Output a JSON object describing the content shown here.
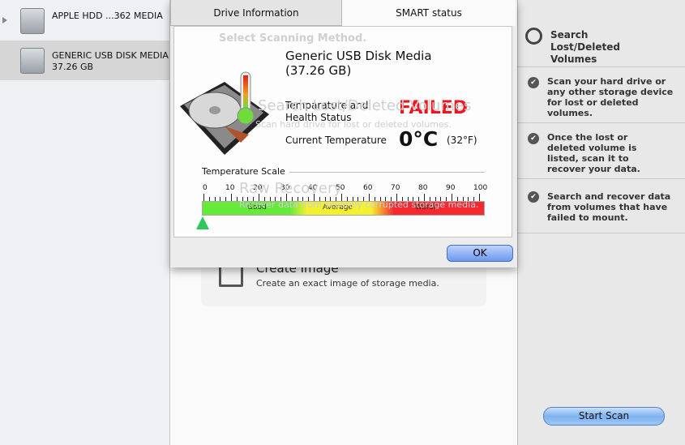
{
  "sidebar": {
    "drives": [
      {
        "name": "APPLE HDD ...362 MEDIA",
        "size": "",
        "expanded": false,
        "selected": false
      },
      {
        "name": "GENERIC USB DISK MEDIA",
        "size": "37.26 GB",
        "selected": true
      }
    ]
  },
  "background": {
    "heading": "Select Scanning Method.",
    "option1_title": "Search Lost/Deleted Volumes",
    "option1_desc": "Scan hard drive for lost or deleted volumes.",
    "option2_title": "Raw Recovery",
    "option2_desc": "Recover data from severely corrupted storage media.",
    "option3_title": "Create Image",
    "option3_desc": "Create an exact image of storage media."
  },
  "right": {
    "title": "Search Lost/Deleted Volumes",
    "points": [
      "Scan your hard drive or any other storage device for lost or deleted volumes.",
      "Once the lost or deleted volume is listed, scan it to recover your data.",
      "Search and recover data from volumes that have failed to mount."
    ],
    "start_label": "Start Scan"
  },
  "dialog": {
    "tabs": [
      {
        "label": "Drive Information",
        "active": false
      },
      {
        "label": "SMART status",
        "active": true
      }
    ],
    "drive_name": "Generic USB Disk Media",
    "drive_size": "(37.26 GB)",
    "health_label": "Temparature and Health Status",
    "health_value": "FAILED",
    "health_color": "#f0141e",
    "temp_label": "Current Temperature",
    "temp_c": "0°C",
    "temp_f": "(32°F)",
    "scale_title": "Temperature Scale",
    "scale_ticks": [
      "0",
      "10",
      "20",
      "30",
      "40",
      "50",
      "60",
      "70",
      "80",
      "90",
      "100"
    ],
    "zones": [
      "Good",
      "Average",
      "Worst"
    ],
    "current_value": 0,
    "ok_label": "OK"
  }
}
